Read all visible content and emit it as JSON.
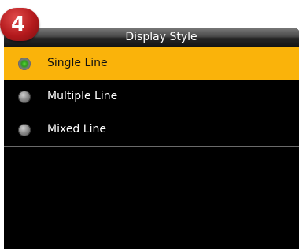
{
  "step_badge": "4",
  "title": "Display Style",
  "options": [
    {
      "label": "Single Line",
      "selected": true
    },
    {
      "label": "Multiple Line",
      "selected": false
    },
    {
      "label": "Mixed Line",
      "selected": false
    }
  ],
  "colors": {
    "highlight": "#fab30a",
    "screen_bg": "#000000",
    "badge": "#b3191c",
    "radio_on": "#2f9e1c"
  },
  "icons": {
    "radio_on": "radio-on-icon",
    "radio_off": "radio-off-icon"
  }
}
